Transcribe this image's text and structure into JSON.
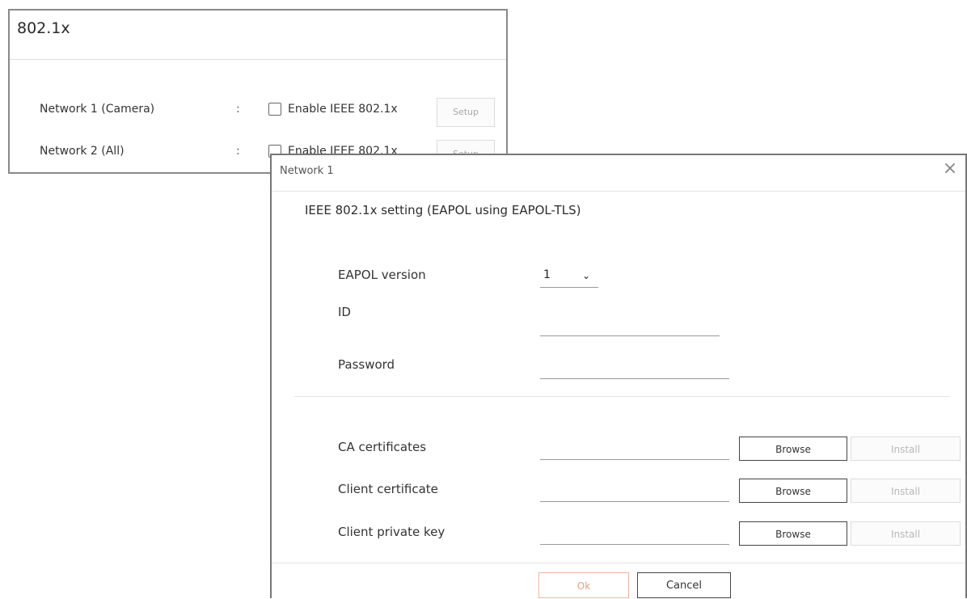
{
  "panel": {
    "title": "802.1x",
    "rows": [
      {
        "label": "Network 1 (Camera)",
        "separator": ":",
        "checkbox_label": "Enable IEEE 802.1x",
        "setup_label": "Setup"
      },
      {
        "label": "Network 2 (All)",
        "separator": ":",
        "checkbox_label": "Enable IEEE 802.1x",
        "setup_label": "Setup"
      }
    ]
  },
  "dialog": {
    "title": "Network 1",
    "close_icon": "×",
    "heading": "IEEE 802.1x setting (EAPOL using EAPOL-TLS)",
    "eapol_version": {
      "label": "EAPOL version",
      "value": "1",
      "chevron": "⌄"
    },
    "id": {
      "label": "ID",
      "value": ""
    },
    "password": {
      "label": "Password",
      "value": ""
    },
    "certificates": [
      {
        "label": "CA certificates",
        "browse": "Browse",
        "install": "Install"
      },
      {
        "label": "Client certificate",
        "browse": "Browse",
        "install": "Install"
      },
      {
        "label": "Client private key",
        "browse": "Browse",
        "install": "Install"
      }
    ],
    "ok_label": "Ok",
    "cancel_label": "Cancel"
  },
  "colors": {
    "ok_border": "#f0b79e",
    "ok_text": "#e0a084",
    "disabled_text": "#b8b8b8"
  }
}
